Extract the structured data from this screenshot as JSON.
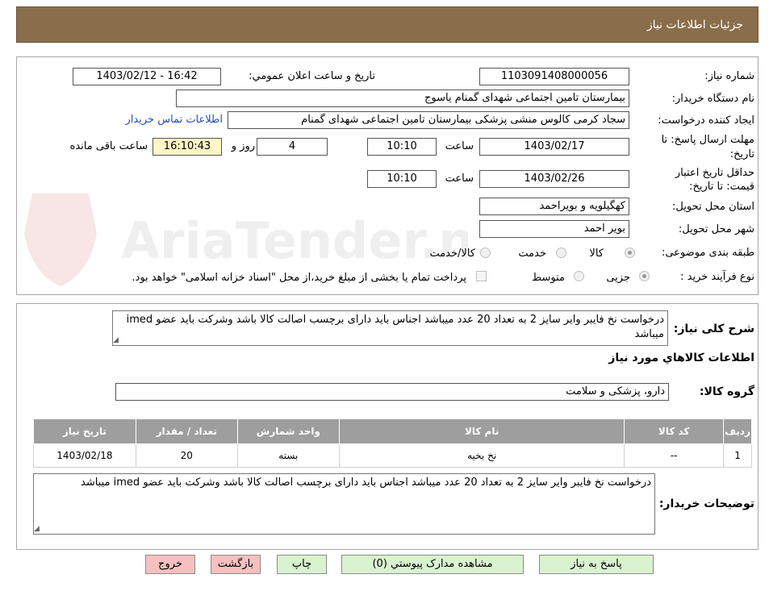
{
  "header": {
    "title": "جزئیات اطلاعات نیاز"
  },
  "watermark": {
    "text": "AriaTender.neT"
  },
  "form": {
    "need_number_label": "شماره نیاز:",
    "need_number": "1103091408000056",
    "announce_label": "تاریخ و ساعت اعلان عمومي:",
    "announce_value": "1403/02/12 - 16:42",
    "buyer_label": "نام دستگاه خریدار:",
    "buyer_value": "بیمارستان تامین اجتماعی شهدای گمنام یاسوج",
    "creator_label": "ایجاد کننده درخواست:",
    "creator_value": "سجاد کرمی کالوس  منشی پزشکی  بیمارستان تامین اجتماعی شهدای گمنام",
    "contact_link": "اطلاعات تماس خریدار",
    "deadline_label_1": "مهلت ارسال پاسخ: تا",
    "deadline_label_2": "تاریخ:",
    "deadline_date": "1403/02/17",
    "time_label": "ساعت",
    "deadline_time": "10:10",
    "days_value": "4",
    "days_label": "روز و",
    "remaining_time": "16:10:43",
    "remaining_label": "ساعت باقی مانده",
    "validity_label_1": "حداقل تاریخ اعتبار",
    "validity_label_2": "قیمت: تا تاریخ:",
    "validity_date": "1403/02/26",
    "validity_time": "10:10",
    "province_label": "استان محل تحویل:",
    "province_value": "کهگیلویه و بویراحمد",
    "city_label": "شهر محل تحویل:",
    "city_value": "بویر احمد",
    "category_label": "طبقه بندی موضوعی:",
    "category_options": [
      "کالا",
      "خدمت",
      "کالا/خدمت"
    ],
    "process_label": "نوع فرآیند خرید :",
    "process_options": [
      "جزیی",
      "متوسط"
    ],
    "payment_note": "پرداخت تمام یا بخشی از مبلغ خرید،از محل \"اسناد خزانه اسلامی\" خواهد بود."
  },
  "description": {
    "label": "شرح کلی نیاز:",
    "text": "درخواست نخ فایبر وایر سایز 2 به تعداد 20 عدد میباشد اجناس باید دارای برچسب اصالت کالا باشد وشرکت باید عضو imed میباشد",
    "goods_info_title": "اطلاعات کالاهاي مورد نیاز",
    "group_label": "گروه کالا:",
    "group_value": "دارو، پزشکی و سلامت"
  },
  "table": {
    "headers": [
      "ردیف",
      "کد کالا",
      "نام کالا",
      "واحد شمارش",
      "تعداد / مقدار",
      "تاریخ نیاز"
    ],
    "rows": [
      [
        "1",
        "--",
        "نخ بخیه",
        "بسته",
        "20",
        "1403/02/18"
      ]
    ]
  },
  "notes": {
    "label": "توضیحات خریدار:",
    "text": "درخواست نخ فایبر وایر سایز 2 به تعداد 20 عدد میباشد اجناس باید دارای برچسب اصالت کالا باشد وشرکت باید عضو imed میباشد"
  },
  "buttons": {
    "reply": "پاسخ به نیاز",
    "attachments": "مشاهده مدارک پیوستي (0)",
    "print": "چاپ",
    "back": "بازگشت",
    "exit": "خروج"
  },
  "colors": {
    "header_bg": "#8a6e4b",
    "button_green": "#d9f2cf",
    "button_red": "#f7c0c0",
    "table_header": "#9e9e9e",
    "link": "#2a49c5"
  }
}
